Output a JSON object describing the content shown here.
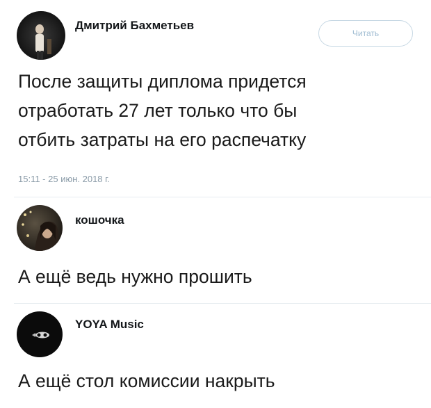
{
  "main_tweet": {
    "author": "Дмитрий Бахметьев",
    "follow_label": "Читать",
    "text_lines": [
      "После защиты диплома придется",
      "отработать 27 лет только что бы",
      "отбить затраты на его распечатку"
    ],
    "timestamp": "15:11 - 25 июн. 2018 г."
  },
  "replies": [
    {
      "author": "кошочка",
      "text": "А ещё ведь нужно прошить"
    },
    {
      "author": "YOYA Music",
      "text": "А ещё стол комиссии накрыть"
    }
  ],
  "colors": {
    "follow_border": "#c7d8e4",
    "follow_text": "#9fbcd2",
    "timestamp": "#8899a6",
    "divider": "#e6ecf0"
  }
}
